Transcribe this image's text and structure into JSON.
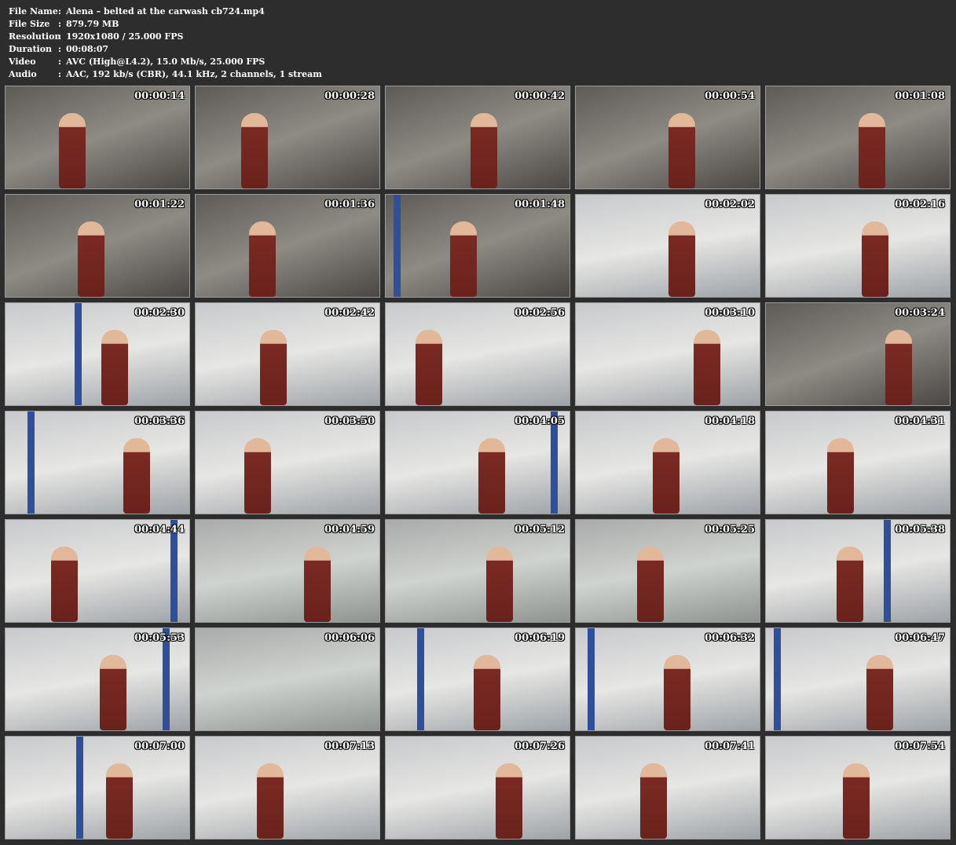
{
  "info": [
    {
      "key": "File Name",
      "value": "Alena – belted at the carwash cb724.mp4"
    },
    {
      "key": "File Size",
      "value": "879.79 MB"
    },
    {
      "key": "Resolution",
      "value": "1920x1080 / 25.000 FPS"
    },
    {
      "key": "Duration",
      "value": "00:08:07"
    },
    {
      "key": "Video",
      "value": "AVC (High@L4.2), 15.0 Mb/s, 25.000 FPS"
    },
    {
      "key": "Audio",
      "value": "AAC, 192 kb/s (CBR), 44.1 kHz, 2 channels, 1 stream"
    }
  ],
  "separator": ":",
  "thumbnails": [
    "00:00:14",
    "00:00:28",
    "00:00:42",
    "00:00:54",
    "00:01:08",
    "00:01:22",
    "00:01:36",
    "00:01:48",
    "00:02:02",
    "00:02:16",
    "00:02:30",
    "00:02:42",
    "00:02:56",
    "00:03:10",
    "00:03:24",
    "00:03:36",
    "00:03:50",
    "00:04:05",
    "00:04:18",
    "00:04:31",
    "00:04:44",
    "00:04:59",
    "00:05:12",
    "00:05:25",
    "00:05:38",
    "00:05:53",
    "00:06:06",
    "00:06:19",
    "00:06:32",
    "00:06:47",
    "00:07:00",
    "00:07:13",
    "00:07:26",
    "00:07:41",
    "00:07:54"
  ],
  "colors": {
    "background": "#2d2d2d",
    "text": "#ffffff",
    "accent_blue": "#2f4f9a",
    "dress": "#7a2a22"
  }
}
